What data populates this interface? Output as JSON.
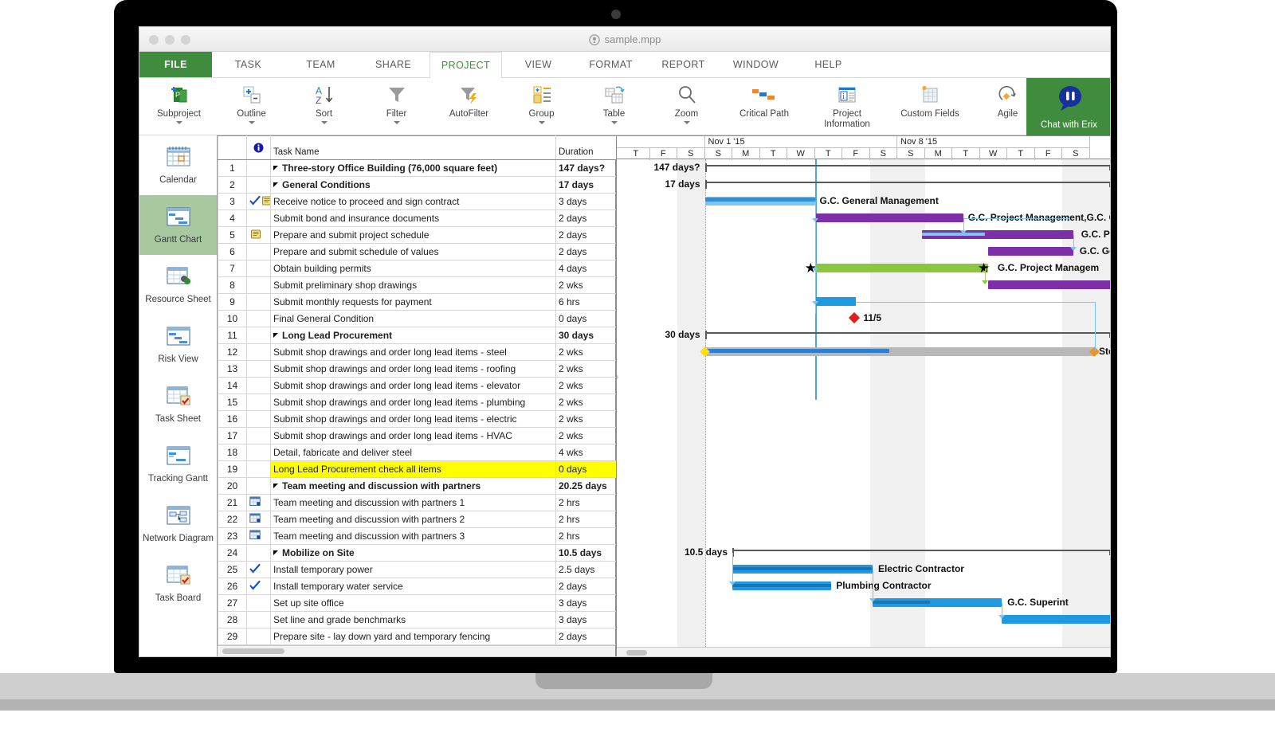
{
  "window": {
    "title": "sample.mpp",
    "doc_icon": "project-document-icon",
    "traffic_lights": [
      "close-button",
      "minimize-button",
      "maximize-button"
    ]
  },
  "ribbon": {
    "tabs": [
      {
        "label": "FILE",
        "state": "file"
      },
      {
        "label": "TASK",
        "state": "normal"
      },
      {
        "label": "TEAM",
        "state": "normal"
      },
      {
        "label": "SHARE",
        "state": "normal"
      },
      {
        "label": "PROJECT",
        "state": "active"
      },
      {
        "label": "VIEW",
        "state": "normal"
      },
      {
        "label": "FORMAT",
        "state": "normal"
      },
      {
        "label": "REPORT",
        "state": "normal"
      },
      {
        "label": "WINDOW",
        "state": "normal"
      },
      {
        "label": "HELP",
        "state": "normal"
      }
    ],
    "buttons": [
      {
        "label": "Subproject",
        "icon": "subproject-icon",
        "caret": true
      },
      {
        "label": "Outline",
        "icon": "outline-icon",
        "caret": true
      },
      {
        "label": "Sort",
        "icon": "sort-az-icon",
        "caret": true
      },
      {
        "label": "Filter",
        "icon": "filter-funnel-icon",
        "caret": true
      },
      {
        "label": "AutoFilter",
        "icon": "autofilter-icon",
        "caret": false
      },
      {
        "label": "Group",
        "icon": "group-icon",
        "caret": true
      },
      {
        "label": "Table",
        "icon": "table-icon",
        "caret": true
      },
      {
        "label": "Zoom",
        "icon": "zoom-magnifier-icon",
        "caret": true
      },
      {
        "label": "Critical Path",
        "icon": "critical-path-icon",
        "caret": false
      },
      {
        "label": "Project Information",
        "icon": "project-information-icon",
        "caret": false
      },
      {
        "label": "Custom Fields",
        "icon": "custom-fields-icon",
        "caret": false
      },
      {
        "label": "Agile",
        "icon": "agile-icon",
        "caret": false
      }
    ],
    "chat_button": {
      "label": "Chat with Erix",
      "icon": "chat-bubble-icon",
      "color": "#3f8c3f"
    }
  },
  "sidebar": {
    "items": [
      {
        "label": "Calendar",
        "icon": "calendar-view-icon",
        "active": false
      },
      {
        "label": "Gantt Chart",
        "icon": "gantt-chart-view-icon",
        "active": true
      },
      {
        "label": "Resource Sheet",
        "icon": "resource-sheet-view-icon",
        "active": false
      },
      {
        "label": "Risk View",
        "icon": "risk-view-icon",
        "active": false
      },
      {
        "label": "Task Sheet",
        "icon": "task-sheet-view-icon",
        "active": false
      },
      {
        "label": "Tracking Gantt",
        "icon": "tracking-gantt-view-icon",
        "active": false
      },
      {
        "label": "Network Diagram",
        "icon": "network-diagram-view-icon",
        "active": false
      },
      {
        "label": "Task Board",
        "icon": "task-board-view-icon",
        "active": false
      }
    ]
  },
  "table": {
    "headers": {
      "id": "",
      "indicator": "info-icon",
      "name": "Task Name",
      "duration": "Duration"
    },
    "rows": [
      {
        "id": "1",
        "name": "Three-story Office Building (76,000 square feet)",
        "duration": "147 days?",
        "level": 0,
        "summary": true,
        "color": "black",
        "indicators": []
      },
      {
        "id": "2",
        "name": "General Conditions",
        "duration": "17 days",
        "level": 1,
        "summary": true,
        "color": "black",
        "indicators": []
      },
      {
        "id": "3",
        "name": "Receive notice to proceed and sign contract",
        "duration": "3 days",
        "level": 2,
        "summary": false,
        "color": "red",
        "indicators": [
          "check-icon",
          "note-icon"
        ]
      },
      {
        "id": "4",
        "name": "Submit bond and insurance documents",
        "duration": "2 days",
        "level": 2,
        "summary": false,
        "color": "red",
        "indicators": []
      },
      {
        "id": "5",
        "name": "Prepare and submit project schedule",
        "duration": "2 days",
        "level": 2,
        "summary": false,
        "color": "red",
        "indicators": [
          "note-icon"
        ]
      },
      {
        "id": "6",
        "name": "Prepare and submit schedule of values",
        "duration": "2 days",
        "level": 2,
        "summary": false,
        "color": "red",
        "indicators": []
      },
      {
        "id": "7",
        "name": "Obtain building permits",
        "duration": "4 days",
        "level": 2,
        "summary": false,
        "color": "red",
        "indicators": []
      },
      {
        "id": "8",
        "name": "Submit preliminary shop drawings",
        "duration": "2 wks",
        "level": 2,
        "summary": false,
        "color": "red",
        "indicators": []
      },
      {
        "id": "9",
        "name": "Submit monthly requests for payment",
        "duration": "6 hrs",
        "level": 2,
        "summary": false,
        "color": "red",
        "indicators": []
      },
      {
        "id": "10",
        "name": "Final General Condition",
        "duration": "0 days",
        "level": 2,
        "summary": false,
        "color": "red",
        "indicators": []
      },
      {
        "id": "11",
        "name": "Long Lead Procurement",
        "duration": "30 days",
        "level": 1,
        "summary": true,
        "color": "black",
        "indicators": []
      },
      {
        "id": "12",
        "name": "Submit shop drawings and order long lead items - steel",
        "duration": "2 wks",
        "level": 2,
        "summary": false,
        "color": "green",
        "indicators": []
      },
      {
        "id": "13",
        "name": "Submit shop drawings and order long lead items - roofing",
        "duration": "2 wks",
        "level": 2,
        "summary": false,
        "color": "green",
        "indicators": []
      },
      {
        "id": "14",
        "name": "Submit shop drawings and order long lead items - elevator",
        "duration": "2 wks",
        "level": 2,
        "summary": false,
        "color": "green",
        "indicators": []
      },
      {
        "id": "15",
        "name": "Submit shop drawings and order long lead items - plumbing",
        "duration": "2 wks",
        "level": 2,
        "summary": false,
        "color": "green",
        "indicators": []
      },
      {
        "id": "16",
        "name": "Submit shop drawings and order long lead items - electric",
        "duration": "2 wks",
        "level": 2,
        "summary": false,
        "color": "green",
        "indicators": []
      },
      {
        "id": "17",
        "name": "Submit shop drawings and order long lead items - HVAC",
        "duration": "2 wks",
        "level": 2,
        "summary": false,
        "color": "green",
        "indicators": []
      },
      {
        "id": "18",
        "name": "Detail, fabricate and deliver steel",
        "duration": "4 wks",
        "level": 2,
        "summary": false,
        "color": "green",
        "indicators": []
      },
      {
        "id": "19",
        "name": "Long Lead Procurement check all items",
        "duration": "0 days",
        "level": 2,
        "summary": false,
        "color": "red",
        "highlight": true,
        "indicators": []
      },
      {
        "id": "20",
        "name": "Team meeting and discussion with partners",
        "duration": "20.25 days",
        "level": 1,
        "summary": true,
        "color": "black",
        "indicators": []
      },
      {
        "id": "21",
        "name": "Team meeting and discussion with partners 1",
        "duration": "2 hrs",
        "level": 2,
        "summary": false,
        "color": "dark",
        "indicators": [
          "calendar-icon"
        ]
      },
      {
        "id": "22",
        "name": "Team meeting and discussion with partners 2",
        "duration": "2 hrs",
        "level": 2,
        "summary": false,
        "color": "dark",
        "indicators": [
          "calendar-icon"
        ]
      },
      {
        "id": "23",
        "name": "Team meeting and discussion with partners 3",
        "duration": "2 hrs",
        "level": 2,
        "summary": false,
        "color": "dark",
        "indicators": [
          "calendar-icon"
        ]
      },
      {
        "id": "24",
        "name": "Mobilize on Site",
        "duration": "10.5 days",
        "level": 1,
        "summary": true,
        "color": "black",
        "indicators": []
      },
      {
        "id": "25",
        "name": "Install temporary power",
        "duration": "2.5 days",
        "level": 2,
        "summary": false,
        "color": "lgreen",
        "indicators": [
          "check-icon"
        ]
      },
      {
        "id": "26",
        "name": "Install temporary water service",
        "duration": "2 days",
        "level": 2,
        "summary": false,
        "color": "lgreen",
        "indicators": [
          "check-icon"
        ]
      },
      {
        "id": "27",
        "name": "Set up site office",
        "duration": "3 days",
        "level": 2,
        "summary": false,
        "color": "lgreen",
        "indicators": []
      },
      {
        "id": "28",
        "name": "Set line and grade benchmarks",
        "duration": "3 days",
        "level": 2,
        "summary": false,
        "color": "lgreen",
        "indicators": []
      },
      {
        "id": "29",
        "name": "Prepare site - lay down yard and temporary fencing",
        "duration": "2 days",
        "level": 2,
        "summary": false,
        "color": "lgreen",
        "indicators": []
      }
    ]
  },
  "gantt": {
    "week_labels": [
      "Nov 1 '15",
      "Nov 8 '15"
    ],
    "day_labels": [
      "T",
      "F",
      "S",
      "S",
      "M",
      "T",
      "W",
      "T",
      "F",
      "S",
      "S",
      "M",
      "T",
      "W",
      "T",
      "F",
      "S"
    ],
    "duration_labels": [
      {
        "row": 1,
        "text": "147 days?"
      },
      {
        "row": 2,
        "text": "17 days"
      },
      {
        "row": 11,
        "text": "30 days"
      },
      {
        "row": 24,
        "text": "10.5 days"
      }
    ],
    "bar_labels": [
      {
        "row": 3,
        "text": "G.C. General Management"
      },
      {
        "row": 4,
        "text": "G.C. Project Management,G.C. General Manag"
      },
      {
        "row": 5,
        "text": "G.C. Project Managem"
      },
      {
        "row": 6,
        "text": "G.C. Gene"
      },
      {
        "row": 7,
        "text": "G.C. Project Managem"
      },
      {
        "row": 12,
        "text": "Stee"
      },
      {
        "row": 25,
        "text": "Electric Contractor"
      },
      {
        "row": 26,
        "text": "Plumbing Contractor"
      },
      {
        "row": 27,
        "text": "G.C. Superint"
      }
    ],
    "milestones": [
      {
        "row": 9,
        "label": "11/5",
        "color": "#e02020"
      }
    ]
  }
}
